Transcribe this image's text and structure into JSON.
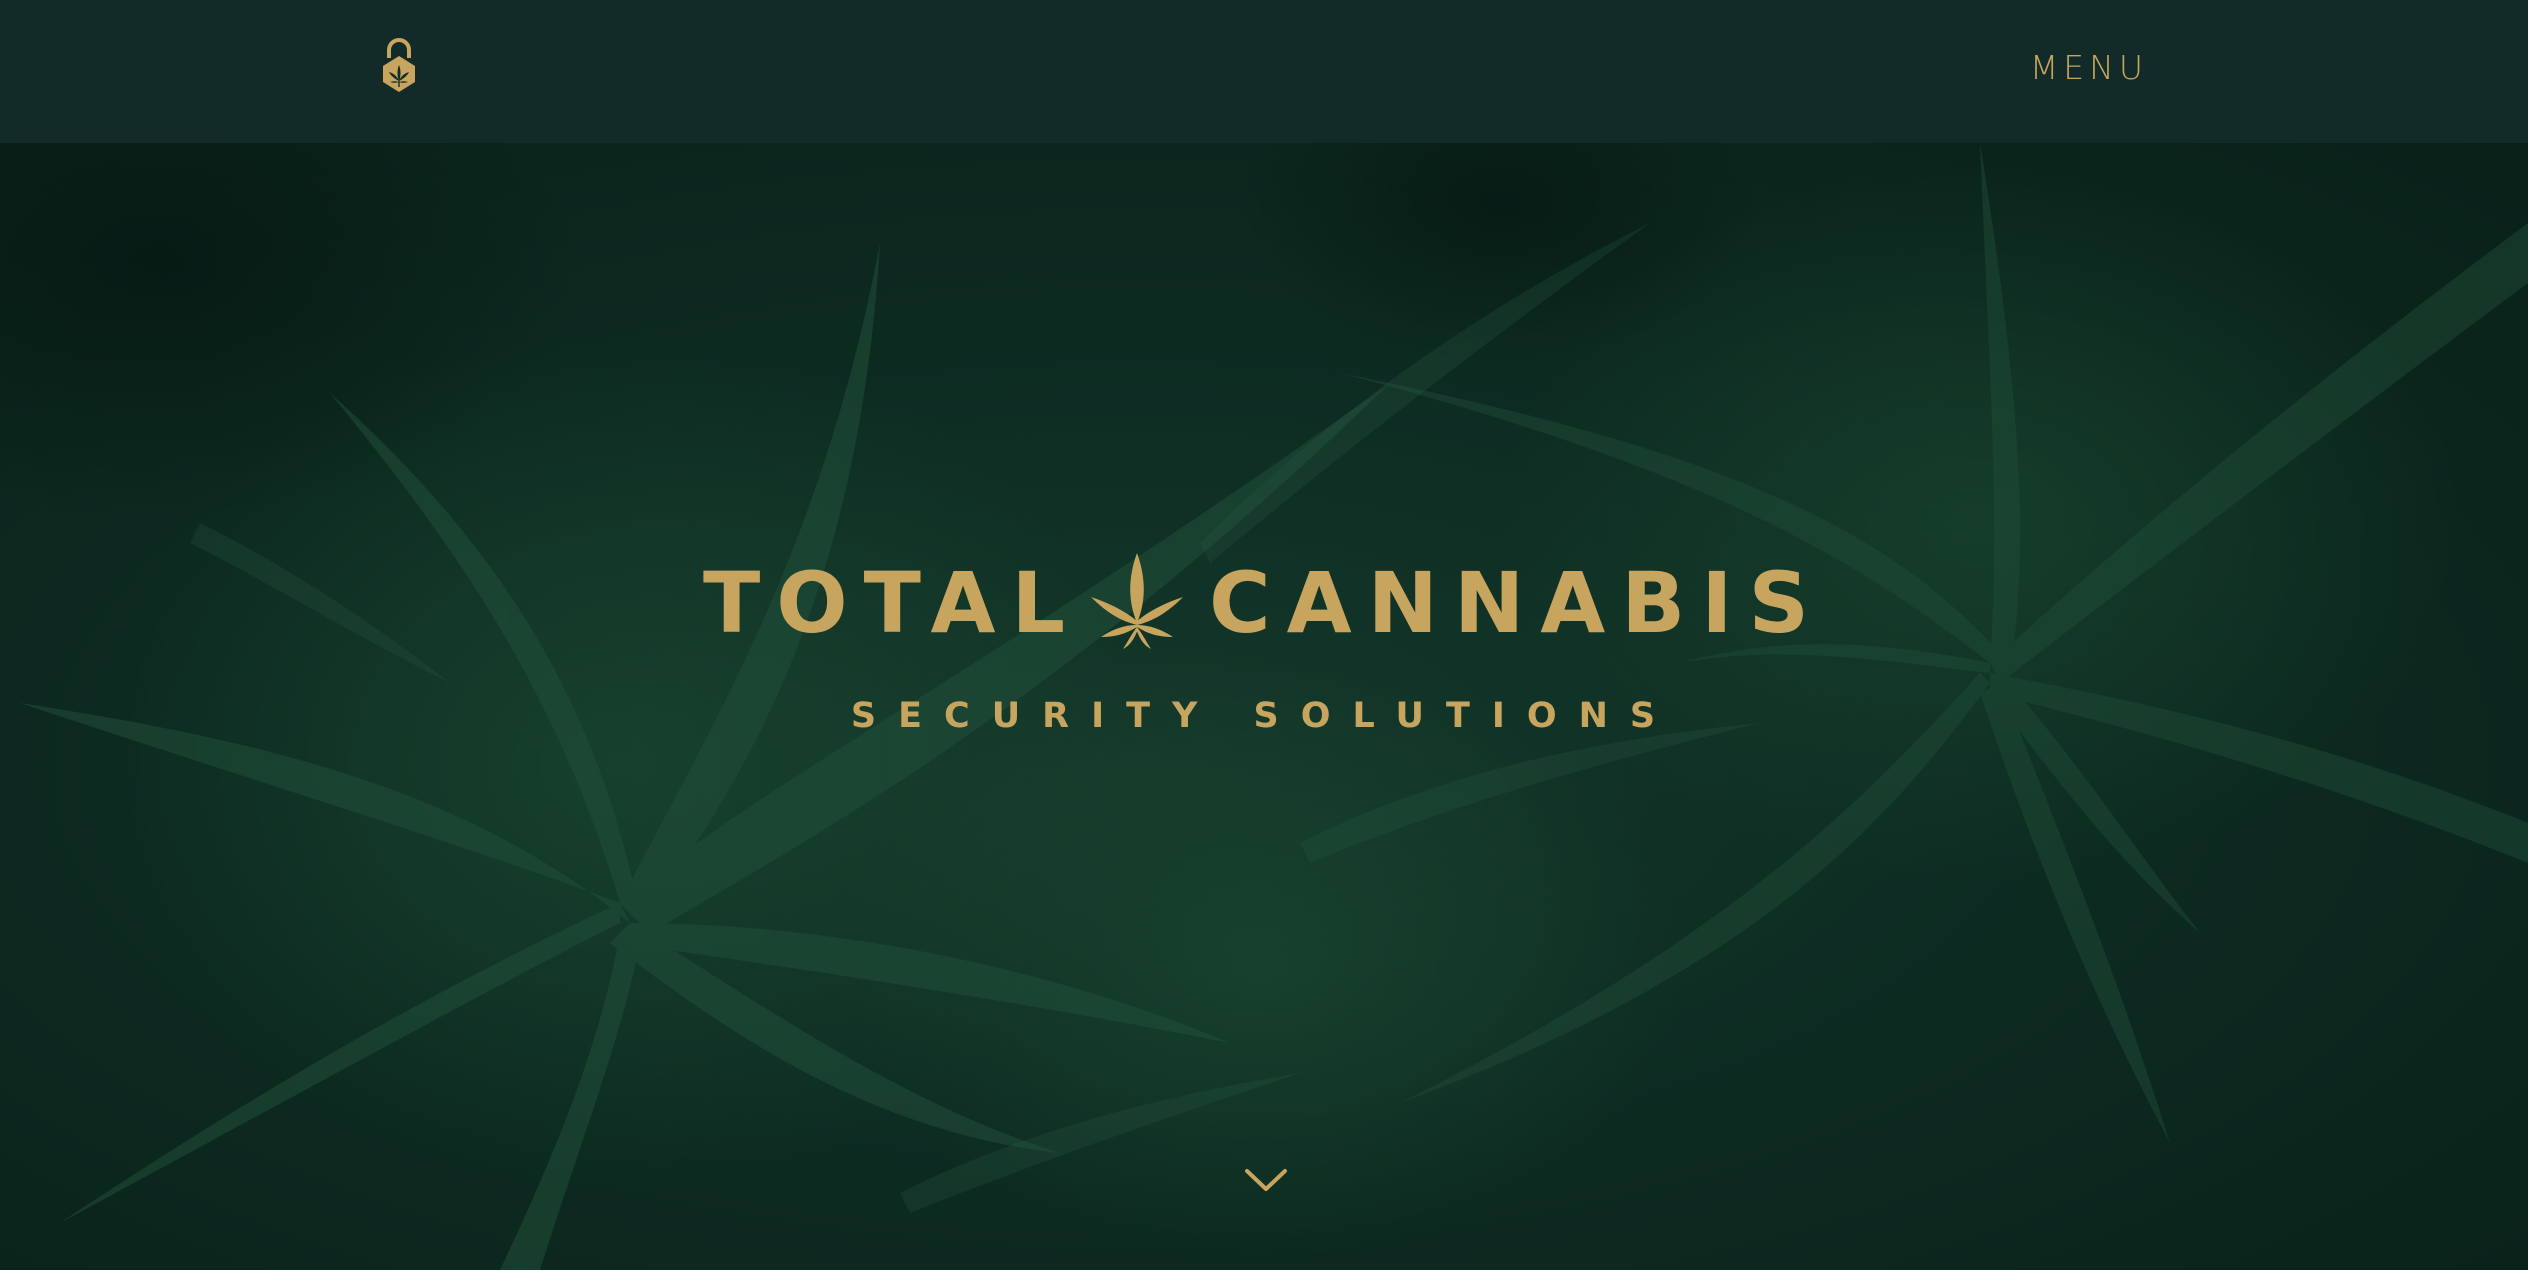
{
  "colors": {
    "header_bg": "#132b28",
    "gold": "#c8a55f",
    "hero_green": "#1d4a38"
  },
  "header": {
    "logo_icon": "padlock-cannabis-leaf-icon",
    "menu_label": "MENU"
  },
  "hero": {
    "brand_left": "TOTAL",
    "brand_icon": "cannabis-leaf-icon",
    "brand_right": "CANNABIS",
    "tagline": "SECURITY SOLUTIONS",
    "background": "cannabis plants photo",
    "scroll_icon": "chevron-down-icon"
  }
}
